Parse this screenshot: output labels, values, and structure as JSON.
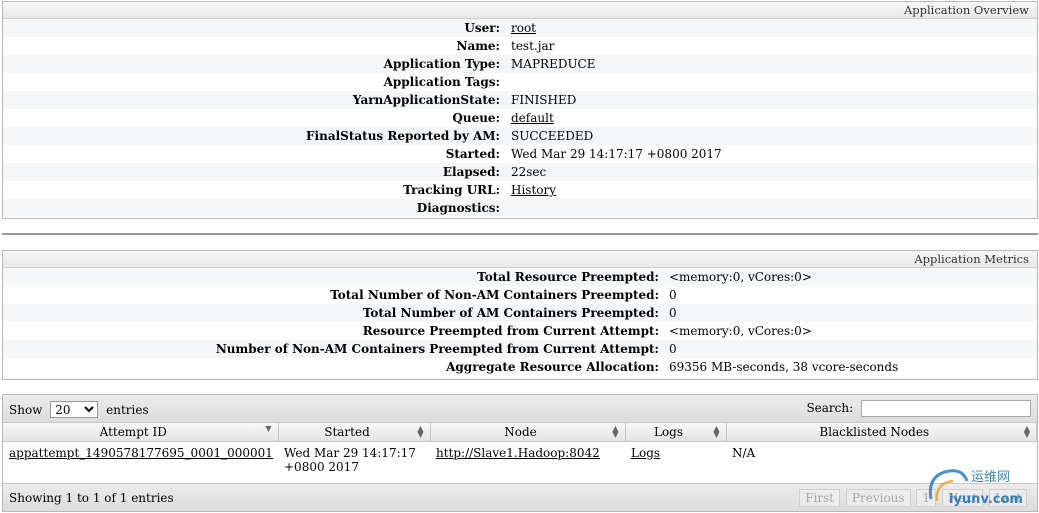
{
  "overview": {
    "title": "Application Overview",
    "rows": [
      {
        "label": "User:",
        "value": "root",
        "link": true
      },
      {
        "label": "Name:",
        "value": "test.jar",
        "link": false
      },
      {
        "label": "Application Type:",
        "value": "MAPREDUCE",
        "link": false
      },
      {
        "label": "Application Tags:",
        "value": "",
        "link": false
      },
      {
        "label": "YarnApplicationState:",
        "value": "FINISHED",
        "link": false
      },
      {
        "label": "Queue:",
        "value": "default",
        "link": true
      },
      {
        "label": "FinalStatus Reported by AM:",
        "value": "SUCCEEDED",
        "link": false
      },
      {
        "label": "Started:",
        "value": "Wed Mar 29 14:17:17 +0800 2017",
        "link": false
      },
      {
        "label": "Elapsed:",
        "value": "22sec",
        "link": false
      },
      {
        "label": "Tracking URL:",
        "value": "History",
        "link": true
      },
      {
        "label": "Diagnostics:",
        "value": "",
        "link": false
      }
    ]
  },
  "metrics": {
    "title": "Application Metrics",
    "rows": [
      {
        "label": "Total Resource Preempted:",
        "value": "<memory:0, vCores:0>"
      },
      {
        "label": "Total Number of Non-AM Containers Preempted:",
        "value": "0"
      },
      {
        "label": "Total Number of AM Containers Preempted:",
        "value": "0"
      },
      {
        "label": "Resource Preempted from Current Attempt:",
        "value": "<memory:0, vCores:0>"
      },
      {
        "label": "Number of Non-AM Containers Preempted from Current Attempt:",
        "value": "0"
      },
      {
        "label": "Aggregate Resource Allocation:",
        "value": "69356 MB-seconds, 38 vcore-seconds"
      }
    ]
  },
  "attempts": {
    "show_label": "Show",
    "entries_label": "entries",
    "page_size": "20",
    "search_label": "Search:",
    "search_value": "",
    "columns": [
      "Attempt ID",
      "Started",
      "Node",
      "Logs",
      "Blacklisted Nodes"
    ],
    "rows": [
      {
        "attempt_id": "appattempt_1490578177695_0001_000001",
        "started": "Wed Mar 29 14:17:17 +0800 2017",
        "node": "http://Slave1.Hadoop:8042",
        "logs": "Logs",
        "blacklisted": "N/A"
      }
    ],
    "info": "Showing 1 to 1 of 1 entries",
    "paging": {
      "first": "First",
      "previous": "Previous",
      "page": "1",
      "next": "Next",
      "last": "Last"
    }
  },
  "watermark": {
    "cn": "运维网",
    "url": "iyunv.com"
  }
}
